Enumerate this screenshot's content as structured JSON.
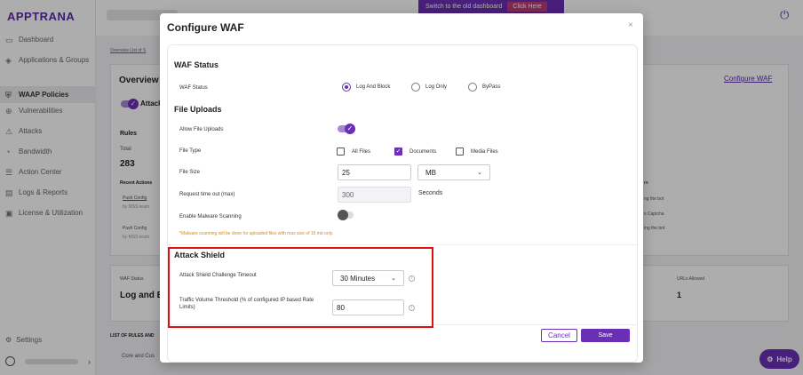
{
  "app": {
    "logo": "APPTRANA"
  },
  "sidebar": {
    "items": [
      {
        "label": "Dashboard",
        "icon": "dashboard-icon"
      },
      {
        "label": "Applications & Groups",
        "icon": "apps-icon"
      },
      {
        "label": "WAAP Policies",
        "icon": "shield-icon"
      },
      {
        "label": "Vulnerabilities",
        "icon": "globe-icon"
      },
      {
        "label": "Attacks",
        "icon": "attack-icon"
      },
      {
        "label": "Bandwidth",
        "icon": "gauge-icon"
      },
      {
        "label": "Action Center",
        "icon": "list-icon"
      },
      {
        "label": "Logs & Reports",
        "icon": "report-icon"
      },
      {
        "label": "License & Utilization",
        "icon": "license-icon"
      }
    ],
    "settings": "Settings"
  },
  "topbar": {
    "switch_text": "Switch to the old dashboard",
    "click_here": "Click Here"
  },
  "background": {
    "crumb": "Overview  List of S",
    "overview": "Overview",
    "attack_toggle": "Attack",
    "rules": "Rules",
    "total": "Total",
    "total_value": "283",
    "recent_actions": "Recent Actions",
    "push1": "Push Config",
    "by1": "by MSS team",
    "push2": "Push Config",
    "by2": "by MSS team",
    "configure_waf": "Configure WAF",
    "right1": "re",
    "right2": "ng the bot",
    "right3": "s Captcha",
    "right4": "ing the bot",
    "waf_status": "WAF Status",
    "log_and": "Log and B",
    "urls_allowed": "URLs Allowed",
    "urls_value": "1",
    "list_rules": "LIST OF RULES AND",
    "core_tab": "Core and Cus",
    "help": "Help"
  },
  "modal": {
    "title": "Configure WAF",
    "close": "×",
    "waf_status": {
      "title": "WAF Status",
      "label": "WAF Status",
      "options": [
        "Log And Block",
        "Log Only",
        "ByPass"
      ],
      "selected": "Log And Block"
    },
    "file_uploads": {
      "title": "File Uploads",
      "allow_label": "Allow File Uploads",
      "allow_on": true,
      "file_type_label": "File Type",
      "file_types": [
        {
          "label": "All Files",
          "checked": false
        },
        {
          "label": "Documents",
          "checked": true
        },
        {
          "label": "Media Files",
          "checked": false
        }
      ],
      "file_size_label": "File Size",
      "file_size_value": "25",
      "file_size_unit": "MB",
      "timeout_label": "Request time out (max)",
      "timeout_value": "300",
      "timeout_unit": "Seconds",
      "malware_label": "Enable Malware Scanning",
      "malware_on": false,
      "malware_note": "*Malware scanning will be done for uploaded files with max size of 15 mb only."
    },
    "attack_shield": {
      "title": "Attack Shield",
      "challenge_label": "Attack Shield Challenge Timeout",
      "challenge_value": "30 Minutes",
      "threshold_label": "Traffic Volume Threshold (% of configured IP based Rate Limits)",
      "threshold_value": "80"
    },
    "cancel": "Cancel",
    "save": "Save"
  },
  "colors": {
    "brand": "#6a2fb5",
    "highlight": "#dd1111",
    "warning": "#e08a00"
  }
}
